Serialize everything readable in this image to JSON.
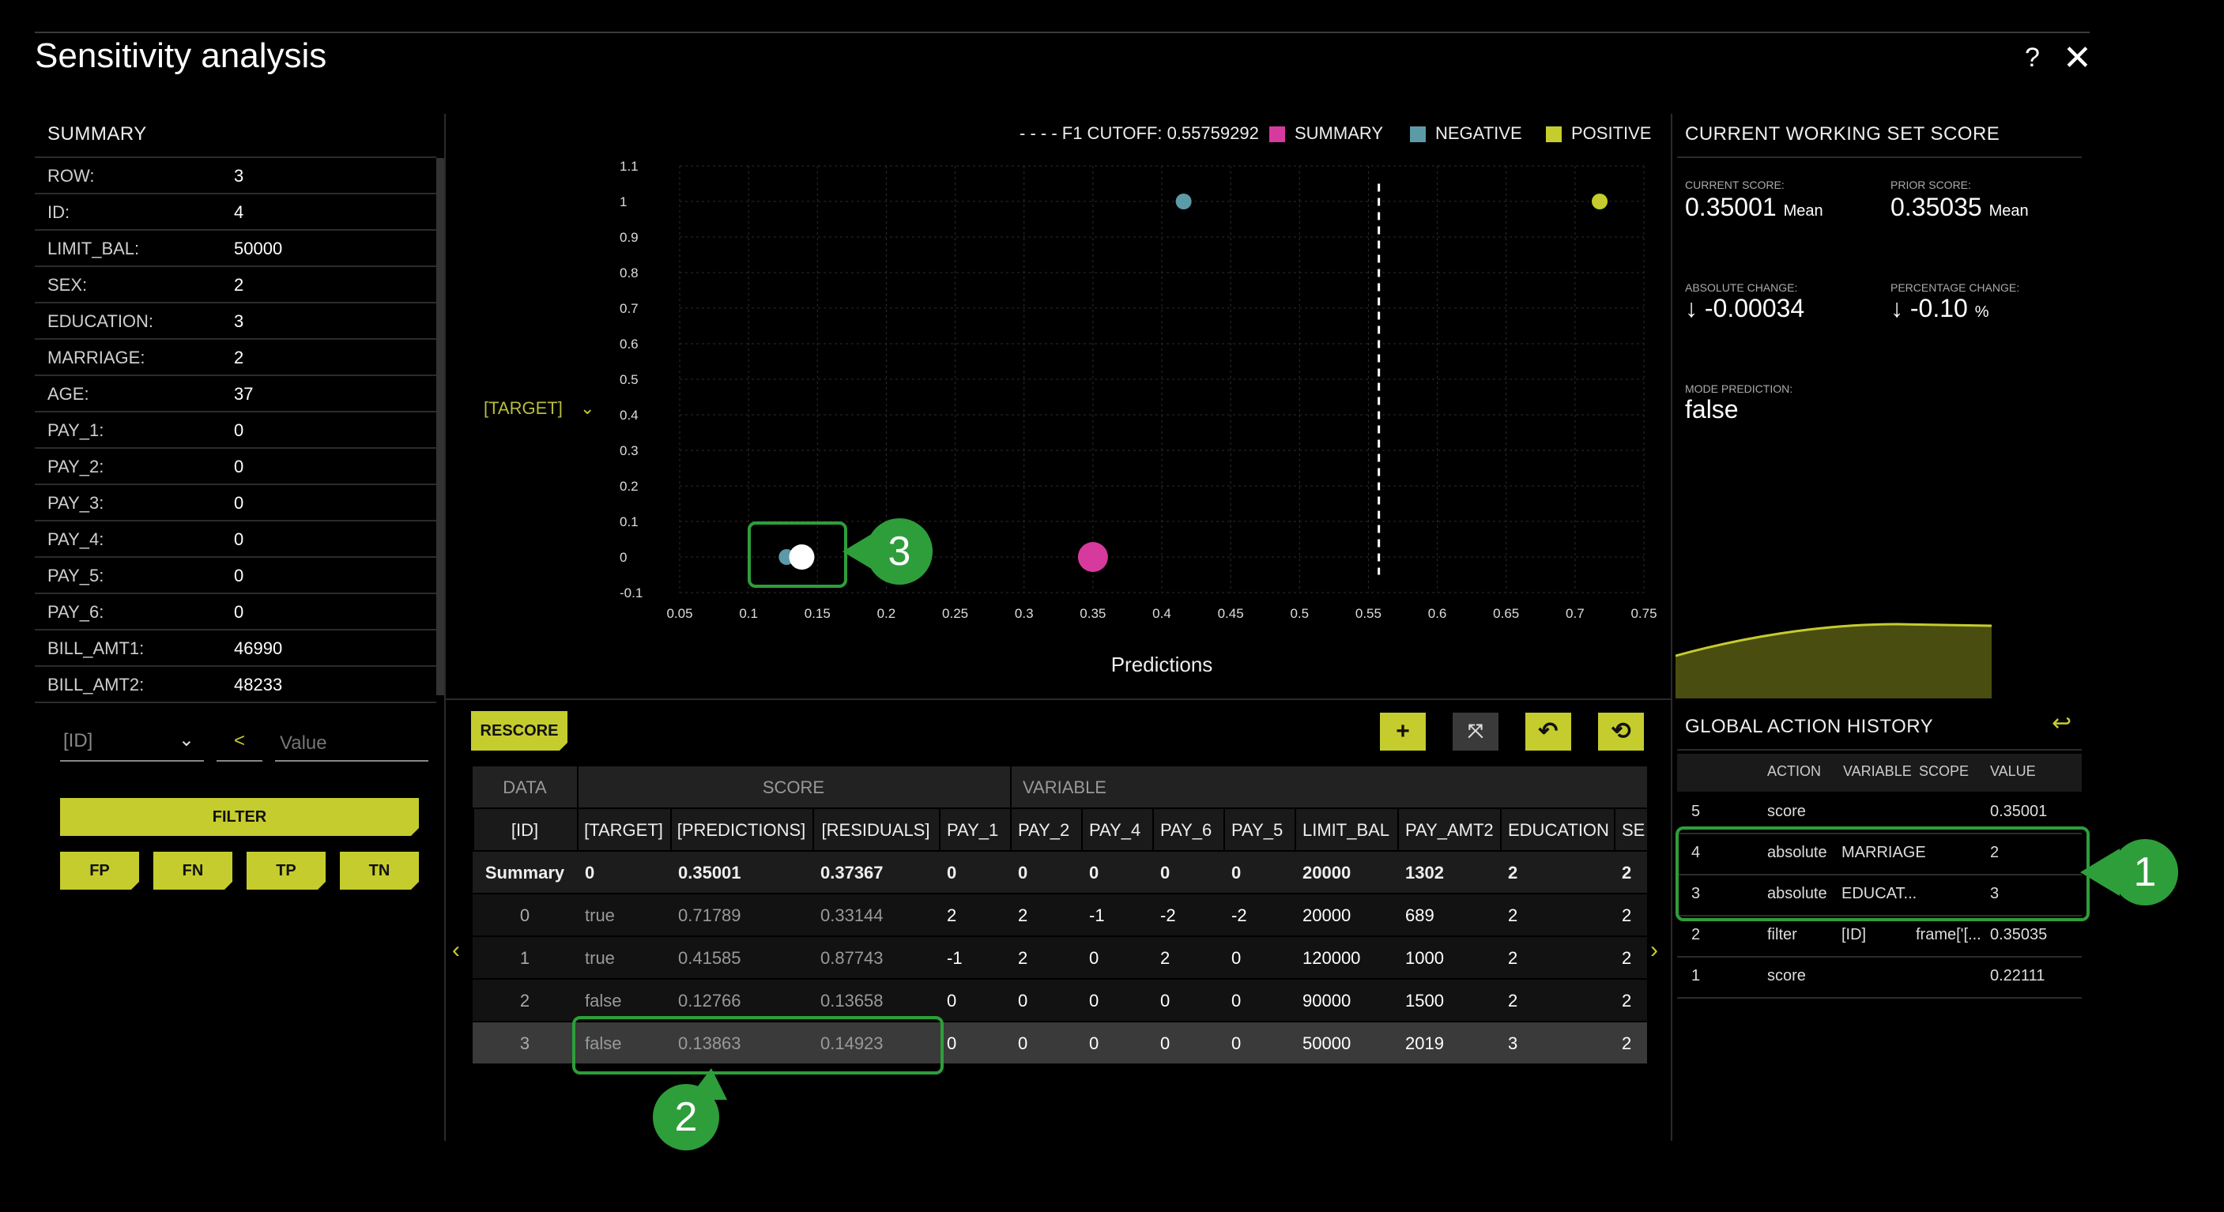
{
  "window": {
    "title": "Sensitivity analysis",
    "help": "?",
    "close": "✕"
  },
  "summary": {
    "title": "SUMMARY",
    "rows": [
      {
        "key": "ROW:",
        "value": "3"
      },
      {
        "key": "ID:",
        "value": "4"
      },
      {
        "key": "LIMIT_BAL:",
        "value": "50000"
      },
      {
        "key": "SEX:",
        "value": "2"
      },
      {
        "key": "EDUCATION:",
        "value": "3"
      },
      {
        "key": "MARRIAGE:",
        "value": "2"
      },
      {
        "key": "AGE:",
        "value": "37"
      },
      {
        "key": "PAY_1:",
        "value": "0"
      },
      {
        "key": "PAY_2:",
        "value": "0"
      },
      {
        "key": "PAY_3:",
        "value": "0"
      },
      {
        "key": "PAY_4:",
        "value": "0"
      },
      {
        "key": "PAY_5:",
        "value": "0"
      },
      {
        "key": "PAY_6:",
        "value": "0"
      },
      {
        "key": "BILL_AMT1:",
        "value": "46990"
      },
      {
        "key": "BILL_AMT2:",
        "value": "48233"
      }
    ]
  },
  "filter": {
    "column": "[ID]",
    "operator": "<",
    "value_placeholder": "Value",
    "filter_label": "FILTER",
    "fp": "FP",
    "fn": "FN",
    "tp": "TP",
    "tn": "TN"
  },
  "chart": {
    "y_selector": "[TARGET]",
    "legend": {
      "cutoff": "F1 CUTOFF: 0.55759292",
      "summary": "SUMMARY",
      "negative": "NEGATIVE",
      "positive": "POSITIVE"
    },
    "colors": {
      "summary": "#d63a9c",
      "negative": "#5d9aa8",
      "positive": "#c5cc2e",
      "selected": "#ffffff"
    }
  },
  "chart_data": {
    "type": "scatter",
    "xlabel": "Predictions",
    "ylabel": "[TARGET]",
    "xlim": [
      0.05,
      0.75
    ],
    "ylim": [
      -0.1,
      1.1
    ],
    "x_ticks": [
      "0.05",
      "0.1",
      "0.15",
      "0.2",
      "0.25",
      "0.3",
      "0.35",
      "0.4",
      "0.45",
      "0.5",
      "0.55",
      "0.6",
      "0.65",
      "0.7",
      "0.75"
    ],
    "y_ticks": [
      "1.1",
      "1",
      "0.9",
      "0.8",
      "0.7",
      "0.6",
      "0.5",
      "0.4",
      "0.3",
      "0.2",
      "0.1",
      "0",
      "-0.1"
    ],
    "cutoff": 0.55759292,
    "series": [
      {
        "name": "SUMMARY",
        "points": [
          {
            "x": 0.35001,
            "y": 0
          }
        ]
      },
      {
        "name": "NEGATIVE",
        "points": [
          {
            "x": 0.41585,
            "y": 1
          },
          {
            "x": 0.12766,
            "y": 0
          }
        ]
      },
      {
        "name": "POSITIVE",
        "points": [
          {
            "x": 0.71789,
            "y": 1
          }
        ]
      },
      {
        "name": "",
        "points": [
          {
            "x": 0.13863,
            "y": 0
          }
        ]
      }
    ]
  },
  "score": {
    "title": "CURRENT WORKING SET SCORE",
    "current_label": "CURRENT SCORE:",
    "current_value": "0.35001",
    "current_unit": "Mean",
    "prior_label": "PRIOR SCORE:",
    "prior_value": "0.35035",
    "prior_unit": "Mean",
    "abs_label": "ABSOLUTE CHANGE:",
    "abs_value": "↓ -0.00034",
    "pct_label": "PERCENTAGE CHANGE:",
    "pct_value": "↓ -0.10",
    "pct_unit": "%",
    "mode_label": "MODE PREDICTION:",
    "mode_value": "false"
  },
  "toolbar": {
    "rescore": "RESCORE"
  },
  "grid": {
    "group_headers": [
      "DATA",
      "SCORE",
      "VARIABLE"
    ],
    "columns": [
      "[ID]",
      "[TARGET]",
      "[PREDICTIONS]",
      "[RESIDUALS]",
      "PAY_1",
      "PAY_2",
      "PAY_4",
      "PAY_6",
      "PAY_5",
      "LIMIT_BAL",
      "PAY_AMT2",
      "EDUCATION",
      "SE"
    ],
    "rows": [
      [
        "Summary",
        "0",
        "0.35001",
        "0.37367",
        "0",
        "0",
        "0",
        "0",
        "0",
        "20000",
        "1302",
        "2",
        "2"
      ],
      [
        "0",
        "true",
        "0.71789",
        "0.33144",
        "2",
        "2",
        "-1",
        "-2",
        "-2",
        "20000",
        "689",
        "2",
        "2"
      ],
      [
        "1",
        "true",
        "0.41585",
        "0.87743",
        "-1",
        "2",
        "0",
        "2",
        "0",
        "120000",
        "1000",
        "2",
        "2"
      ],
      [
        "2",
        "false",
        "0.12766",
        "0.13658",
        "0",
        "0",
        "0",
        "0",
        "0",
        "90000",
        "1500",
        "2",
        "2"
      ],
      [
        "3",
        "false",
        "0.13863",
        "0.14923",
        "0",
        "0",
        "0",
        "0",
        "0",
        "50000",
        "2019",
        "3",
        "2"
      ]
    ]
  },
  "history": {
    "title": "GLOBAL ACTION HISTORY",
    "columns": [
      "ACTION",
      "VARIABLE",
      "SCOPE",
      "VALUE"
    ],
    "rows": [
      [
        "5",
        "score",
        "",
        "",
        "0.35001"
      ],
      [
        "4",
        "absolute",
        "MARRIAGE",
        "",
        "2"
      ],
      [
        "3",
        "absolute",
        "EDUCAT...",
        "",
        "3"
      ],
      [
        "2",
        "filter",
        "[ID]",
        "frame['[...",
        "0.35035"
      ],
      [
        "1",
        "score",
        "",
        "",
        "0.22111"
      ]
    ]
  },
  "callouts": [
    "1",
    "2",
    "3"
  ]
}
